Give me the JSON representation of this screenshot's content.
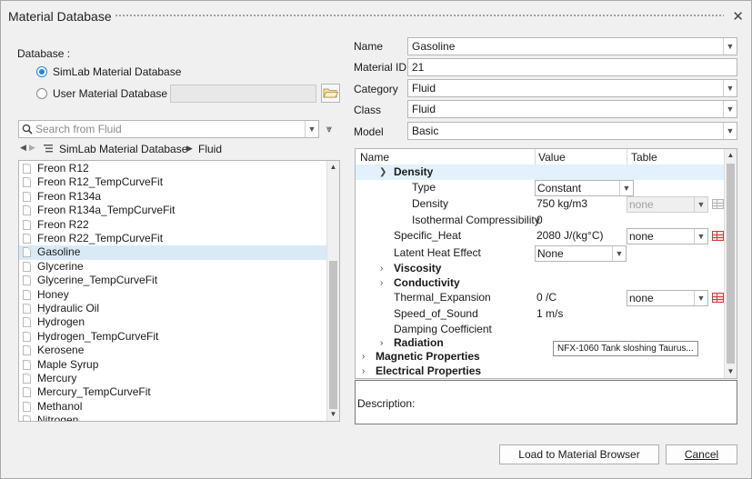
{
  "window": {
    "title": "Material Database"
  },
  "left": {
    "database_label": "Database :",
    "db_simlab": "SimLab Material Database",
    "db_user": "User Material Database",
    "user_db_path": "",
    "search_placeholder": "Search from Fluid",
    "breadcrumb": {
      "root": "SimLab Material Database",
      "current": "Fluid"
    },
    "materials": [
      "Freon R12",
      "Freon R12_TempCurveFit",
      "Freon R134a",
      "Freon R134a_TempCurveFit",
      "Freon R22",
      "Freon R22_TempCurveFit",
      "Gasoline",
      "Glycerine",
      "Glycerine_TempCurveFit",
      "Honey",
      "Hydraulic Oil",
      "Hydrogen",
      "Hydrogen_TempCurveFit",
      "Kerosene",
      "Maple Syrup",
      "Mercury",
      "Mercury_TempCurveFit",
      "Methanol",
      "Nitrogen"
    ],
    "selected_index": 6
  },
  "form": {
    "name_label": "Name",
    "name_value": "Gasoline",
    "id_label": "Material ID",
    "id_value": "21",
    "category_label": "Category",
    "category_value": "Fluid",
    "class_label": "Class",
    "class_value": "Fluid",
    "model_label": "Model",
    "model_value": "Basic"
  },
  "grid": {
    "headers": {
      "name": "Name",
      "value": "Value",
      "table": "Table"
    },
    "density_group": "Density",
    "type_label": "Type",
    "type_value": "Constant",
    "density_label": "Density",
    "density_value": "750 kg/m3",
    "density_table": "none",
    "iso_label": "Isothermal Compressibility",
    "iso_value": "0",
    "specific_heat_label": "Specific_Heat",
    "specific_heat_value": "2080 J/(kg°C)",
    "specific_heat_table": "none",
    "latent_label": "Latent Heat Effect",
    "latent_value": "None",
    "viscosity_group": "Viscosity",
    "conductivity_group": "Conductivity",
    "thermal_label": "Thermal_Expansion",
    "thermal_value": "0 /C",
    "thermal_table": "none",
    "sound_label": "Speed_of_Sound",
    "sound_value": "1 m/s",
    "damping_label": "Damping Coefficient",
    "radiation_group": "Radiation",
    "magnetic_group": "Magnetic Properties",
    "electrical_group": "Electrical Properties"
  },
  "tooltip": "NFX-1060 Tank sloshing Taurus...",
  "description_label": "Description:",
  "buttons": {
    "load": "Load to Material Browser",
    "cancel": "Cancel"
  },
  "colors": {
    "accent": "#1e88e5",
    "selection": "#d9eaf7",
    "table_icon": "#d23b3b"
  }
}
